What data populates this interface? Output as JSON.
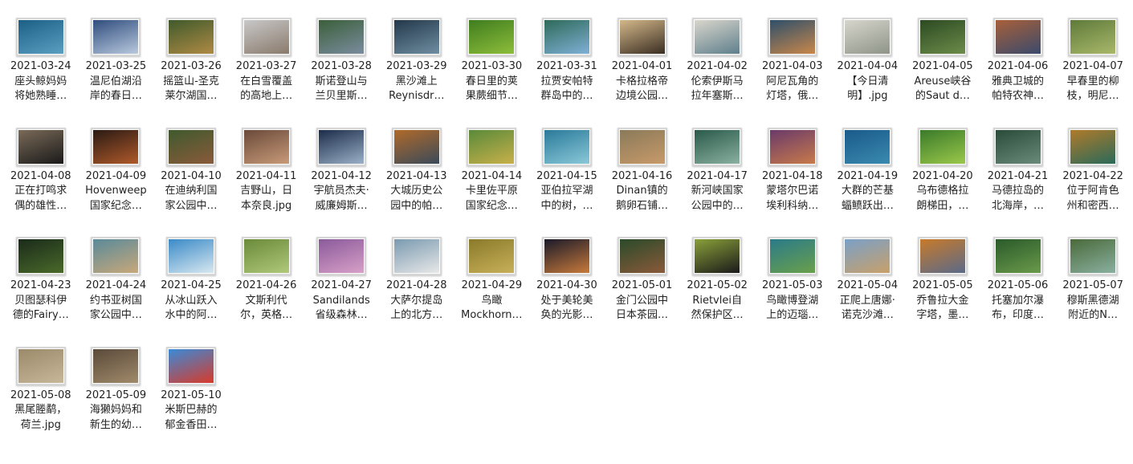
{
  "files": [
    {
      "name_line1": "2021-03-24",
      "name_line2": "座头鲸妈妈",
      "name_line3": "将她熟睡…",
      "thumb_colors": [
        "#1c5f86",
        "#5aa0c2"
      ]
    },
    {
      "name_line1": "2021-03-25",
      "name_line2": "温尼伯湖沿",
      "name_line3": "岸的春日…",
      "thumb_colors": [
        "#2f4d7d",
        "#b9c9de"
      ]
    },
    {
      "name_line1": "2021-03-26",
      "name_line2": "摇篮山-圣克",
      "name_line3": "莱尔湖国…",
      "thumb_colors": [
        "#3f5a2c",
        "#b08a44"
      ]
    },
    {
      "name_line1": "2021-03-27",
      "name_line2": "在白雪覆盖",
      "name_line3": "的高地上…",
      "thumb_colors": [
        "#c8c8c8",
        "#8a7a6c"
      ]
    },
    {
      "name_line1": "2021-03-28",
      "name_line2": "斯诺登山与",
      "name_line3": "兰贝里斯…",
      "thumb_colors": [
        "#3b5f3a",
        "#7a8c9e"
      ]
    },
    {
      "name_line1": "2021-03-29",
      "name_line2": "黑沙滩上",
      "name_line3": "Reynisdr…",
      "thumb_colors": [
        "#23384a",
        "#6f8ea2"
      ]
    },
    {
      "name_line1": "2021-03-30",
      "name_line2": "春日里的荚",
      "name_line3": "果蕨细节…",
      "thumb_colors": [
        "#3f7d1f",
        "#8dbd3a"
      ]
    },
    {
      "name_line1": "2021-03-31",
      "name_line2": "拉贾安帕特",
      "name_line3": "群岛中的…",
      "thumb_colors": [
        "#2e6a5a",
        "#7fb0d6"
      ]
    },
    {
      "name_line1": "2021-04-01",
      "name_line2": "卡格拉格帝",
      "name_line3": "边境公园…",
      "thumb_colors": [
        "#d4b88a",
        "#3a2e22"
      ]
    },
    {
      "name_line1": "2021-04-02",
      "name_line2": "伦索伊斯马",
      "name_line3": "拉年塞斯…",
      "thumb_colors": [
        "#d9d6cc",
        "#5f7f8c"
      ]
    },
    {
      "name_line1": "2021-04-03",
      "name_line2": "阿尼瓦角的",
      "name_line3": "灯塔，俄…",
      "thumb_colors": [
        "#2e4f6b",
        "#c9874a"
      ]
    },
    {
      "name_line1": "2021-04-04",
      "name_line2": "【今日清",
      "name_line3": "明】.jpg",
      "thumb_colors": [
        "#d7d6cc",
        "#8e9488"
      ]
    },
    {
      "name_line1": "2021-04-05",
      "name_line2": "Areuse峡谷",
      "name_line3": "的Saut d…",
      "thumb_colors": [
        "#2c4a22",
        "#6b8c4a"
      ]
    },
    {
      "name_line1": "2021-04-06",
      "name_line2": "雅典卫城的",
      "name_line3": "帕特农神…",
      "thumb_colors": [
        "#a8603a",
        "#3a4a6c"
      ]
    },
    {
      "name_line1": "2021-04-07",
      "name_line2": "早春里的柳",
      "name_line3": "枝，明尼…",
      "thumb_colors": [
        "#5e7a3a",
        "#a9b86a"
      ]
    },
    {
      "name_line1": "2021-04-08",
      "name_line2": "正在打鸣求",
      "name_line3": "偶的雄性…",
      "thumb_colors": [
        "#7a6a58",
        "#1a1a1a"
      ]
    },
    {
      "name_line1": "2021-04-09",
      "name_line2": "Hovenweep",
      "name_line3": "国家纪念…",
      "thumb_colors": [
        "#2a1a14",
        "#b05a2a"
      ]
    },
    {
      "name_line1": "2021-04-10",
      "name_line2": "在迪纳利国",
      "name_line3": "家公园中…",
      "thumb_colors": [
        "#3f5a2e",
        "#8a5a3a"
      ]
    },
    {
      "name_line1": "2021-04-11",
      "name_line2": "吉野山，日",
      "name_line3": "本奈良.jpg",
      "thumb_colors": [
        "#6a4a3a",
        "#c89a78"
      ]
    },
    {
      "name_line1": "2021-04-12",
      "name_line2": "宇航员杰夫·",
      "name_line3": "威廉姆斯…",
      "thumb_colors": [
        "#1c2c4a",
        "#9ab0c8"
      ]
    },
    {
      "name_line1": "2021-04-13",
      "name_line2": "大城历史公",
      "name_line3": "园中的帕…",
      "thumb_colors": [
        "#b06a2a",
        "#3a4a5a"
      ]
    },
    {
      "name_line1": "2021-04-14",
      "name_line2": "卡里佐平原",
      "name_line3": "国家纪念…",
      "thumb_colors": [
        "#5a8a3a",
        "#c8b04a"
      ]
    },
    {
      "name_line1": "2021-04-15",
      "name_line2": "亚伯拉罕湖",
      "name_line3": "中的树，…",
      "thumb_colors": [
        "#2a7a9a",
        "#8ac8d8"
      ]
    },
    {
      "name_line1": "2021-04-16",
      "name_line2": "Dinan镇的",
      "name_line3": "鹅卵石铺…",
      "thumb_colors": [
        "#8a7a5a",
        "#c89a6a"
      ]
    },
    {
      "name_line1": "2021-04-17",
      "name_line2": "新河峡国家",
      "name_line3": "公园中的…",
      "thumb_colors": [
        "#2a5a4a",
        "#8ab0a0"
      ]
    },
    {
      "name_line1": "2021-04-18",
      "name_line2": "蒙塔尔巴诺",
      "name_line3": "埃利科纳…",
      "thumb_colors": [
        "#6a3a6a",
        "#c87a4a"
      ]
    },
    {
      "name_line1": "2021-04-19",
      "name_line2": "大群的芒基",
      "name_line3": "蝠鲼跃出…",
      "thumb_colors": [
        "#1a5a8a",
        "#3a8ab0"
      ]
    },
    {
      "name_line1": "2021-04-20",
      "name_line2": "乌布德格拉",
      "name_line3": "朗梯田，…",
      "thumb_colors": [
        "#3a7a2a",
        "#9ac84a"
      ]
    },
    {
      "name_line1": "2021-04-21",
      "name_line2": "马德拉岛的",
      "name_line3": "北海岸，…",
      "thumb_colors": [
        "#2a4a3a",
        "#6a8a7a"
      ]
    },
    {
      "name_line1": "2021-04-22",
      "name_line2": "位于阿肯色",
      "name_line3": "州和密西…",
      "thumb_colors": [
        "#b07a2a",
        "#2a6a5a"
      ]
    },
    {
      "name_line1": "2021-04-23",
      "name_line2": "贝图瑟科伊",
      "name_line3": "德的Fairy…",
      "thumb_colors": [
        "#1a2a1a",
        "#4a6a2a"
      ]
    },
    {
      "name_line1": "2021-04-24",
      "name_line2": "约书亚树国",
      "name_line3": "家公园中…",
      "thumb_colors": [
        "#5a8a9a",
        "#c8a87a"
      ]
    },
    {
      "name_line1": "2021-04-25",
      "name_line2": "从冰山跃入",
      "name_line3": "水中的阿…",
      "thumb_colors": [
        "#3a8ac8",
        "#d8e8f0"
      ]
    },
    {
      "name_line1": "2021-04-26",
      "name_line2": "文斯利代",
      "name_line3": "尔，英格…",
      "thumb_colors": [
        "#6a8a3a",
        "#b0c87a"
      ]
    },
    {
      "name_line1": "2021-04-27",
      "name_line2": "Sandilands",
      "name_line3": "省级森林…",
      "thumb_colors": [
        "#8a5a9a",
        "#d8a0c8"
      ]
    },
    {
      "name_line1": "2021-04-28",
      "name_line2": "大萨尔提岛",
      "name_line3": "上的北方…",
      "thumb_colors": [
        "#7a9ab0",
        "#e8e8e8"
      ]
    },
    {
      "name_line1": "2021-04-29",
      "name_line2": "鸟瞰",
      "name_line3": "Mockhorn…",
      "thumb_colors": [
        "#8a7a2a",
        "#c8b05a"
      ]
    },
    {
      "name_line1": "2021-04-30",
      "name_line2": "处于美轮美",
      "name_line3": "奂的光影…",
      "thumb_colors": [
        "#1a1a2a",
        "#c87a3a"
      ]
    },
    {
      "name_line1": "2021-05-01",
      "name_line2": "金门公园中",
      "name_line3": "日本茶园…",
      "thumb_colors": [
        "#2a4a2a",
        "#8a5a3a"
      ]
    },
    {
      "name_line1": "2021-05-02",
      "name_line2": "Rietvlei自",
      "name_line3": "然保护区…",
      "thumb_colors": [
        "#8aa03a",
        "#1a1a1a"
      ]
    },
    {
      "name_line1": "2021-05-03",
      "name_line2": "鸟瞰博登湖",
      "name_line3": "上的迈瑙…",
      "thumb_colors": [
        "#2a7a8a",
        "#6aa04a"
      ]
    },
    {
      "name_line1": "2021-05-04",
      "name_line2": "正爬上唐娜·",
      "name_line3": "诺克沙滩…",
      "thumb_colors": [
        "#7aa0c8",
        "#c8a06a"
      ]
    },
    {
      "name_line1": "2021-05-05",
      "name_line2": "乔鲁拉大金",
      "name_line3": "字塔，墨…",
      "thumb_colors": [
        "#c87a2a",
        "#5a6a8a"
      ]
    },
    {
      "name_line1": "2021-05-06",
      "name_line2": "托塞加尔瀑",
      "name_line3": "布，印度…",
      "thumb_colors": [
        "#2a5a2a",
        "#6a9a4a"
      ]
    },
    {
      "name_line1": "2021-05-07",
      "name_line2": "穆斯黑德湖",
      "name_line3": "附近的N…",
      "thumb_colors": [
        "#4a6a3a",
        "#8ab0a0"
      ]
    },
    {
      "name_line1": "2021-05-08",
      "name_line2": "黑尾塍鹬，",
      "name_line3": "荷兰.jpg",
      "thumb_colors": [
        "#9a8a6a",
        "#c8b89a"
      ]
    },
    {
      "name_line1": "2021-05-09",
      "name_line2": "海獭妈妈和",
      "name_line3": "新生的幼…",
      "thumb_colors": [
        "#5a4a3a",
        "#a08a6a"
      ]
    },
    {
      "name_line1": "2021-05-10",
      "name_line2": "米斯巴赫的",
      "name_line3": "郁金香田…",
      "thumb_colors": [
        "#3a8ad8",
        "#d83a2a"
      ]
    }
  ]
}
